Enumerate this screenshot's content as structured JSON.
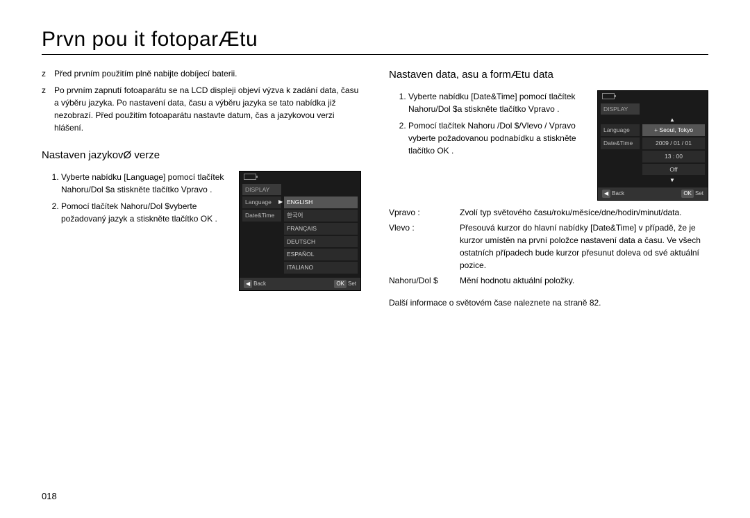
{
  "title": "Prvn  pou it  fotoparÆtu",
  "pagenum": "018",
  "intro": [
    "Před prvním použitím plně nabijte dobíjecí baterii.",
    "Po prvním zapnutí fotoaparátu se na LCD displeji objeví výzva k zadání data, času a výběru jazyka. Po nastavení data, času a výběru jazyka se tato nabídka již nezobrazí. Před použitím fotoaparátu nastavte datum, čas a jazykovou verzi hlášení."
  ],
  "left": {
    "heading": "Nastaven  jazykovØ verze",
    "steps": [
      "Vyberte nabídku [Language] pomocí tlačítek Nahoru/Dol  $a stiskněte tlačítko Vpravo .",
      "Pomocí tlačítek Nahoru/Dol  $vyberte požadovaný jazyk a stiskněte tlačítko OK ."
    ],
    "lcd": {
      "heading": "DISPLAY",
      "row1_label": "Language",
      "row1_value": "ENGLISH",
      "row2_label": "Date&Time",
      "row2_value": "한국어",
      "values": [
        "FRANÇAIS",
        "DEUTSCH",
        "ESPAÑOL",
        "ITALIANO"
      ],
      "foot_left": "Back",
      "foot_right": "Set"
    }
  },
  "right": {
    "heading": "Nastaven  data,    asu a formÆtu data",
    "steps": [
      "Vyberte nabídku [Date&Time] pomocí tlačítek Nahoru/Dol  $a stiskněte tlačítko Vpravo .",
      "Pomocí tlačítek Nahoru /Dol $/Vlevo / Vpravo  vyberte požadovanou podnabídku a stiskněte tlačítko OK ."
    ],
    "lcd": {
      "heading": "DISPLAY",
      "row1_label": "Language",
      "row1_hl": "+ Seoul, Tokyo",
      "row2_label": "Date&Time",
      "row2_value": "2009 / 01 / 01",
      "row3_value": "13 : 00",
      "row4_value": "Off",
      "foot_left": "Back",
      "foot_right": "Set"
    },
    "kv": [
      {
        "k": "Vpravo :",
        "v": "Zvolí typ světového času/roku/měsíce/dne/hodin/minut/data."
      },
      {
        "k": "Vlevo :",
        "v": "Přesouvá kurzor do hlavní nabídky [Date&Time] v případě, že je kurzor umístěn na první položce nastavení data a času. Ve všech ostatních případech bude kurzor přesunut doleva od své aktuální pozice."
      },
      {
        "k": "Nahoru/Dol  $",
        "v": "Mění hodnotu aktuální položky."
      }
    ],
    "note": "Další informace o světovém čase naleznete na straně 82."
  },
  "bullet_char": "z"
}
